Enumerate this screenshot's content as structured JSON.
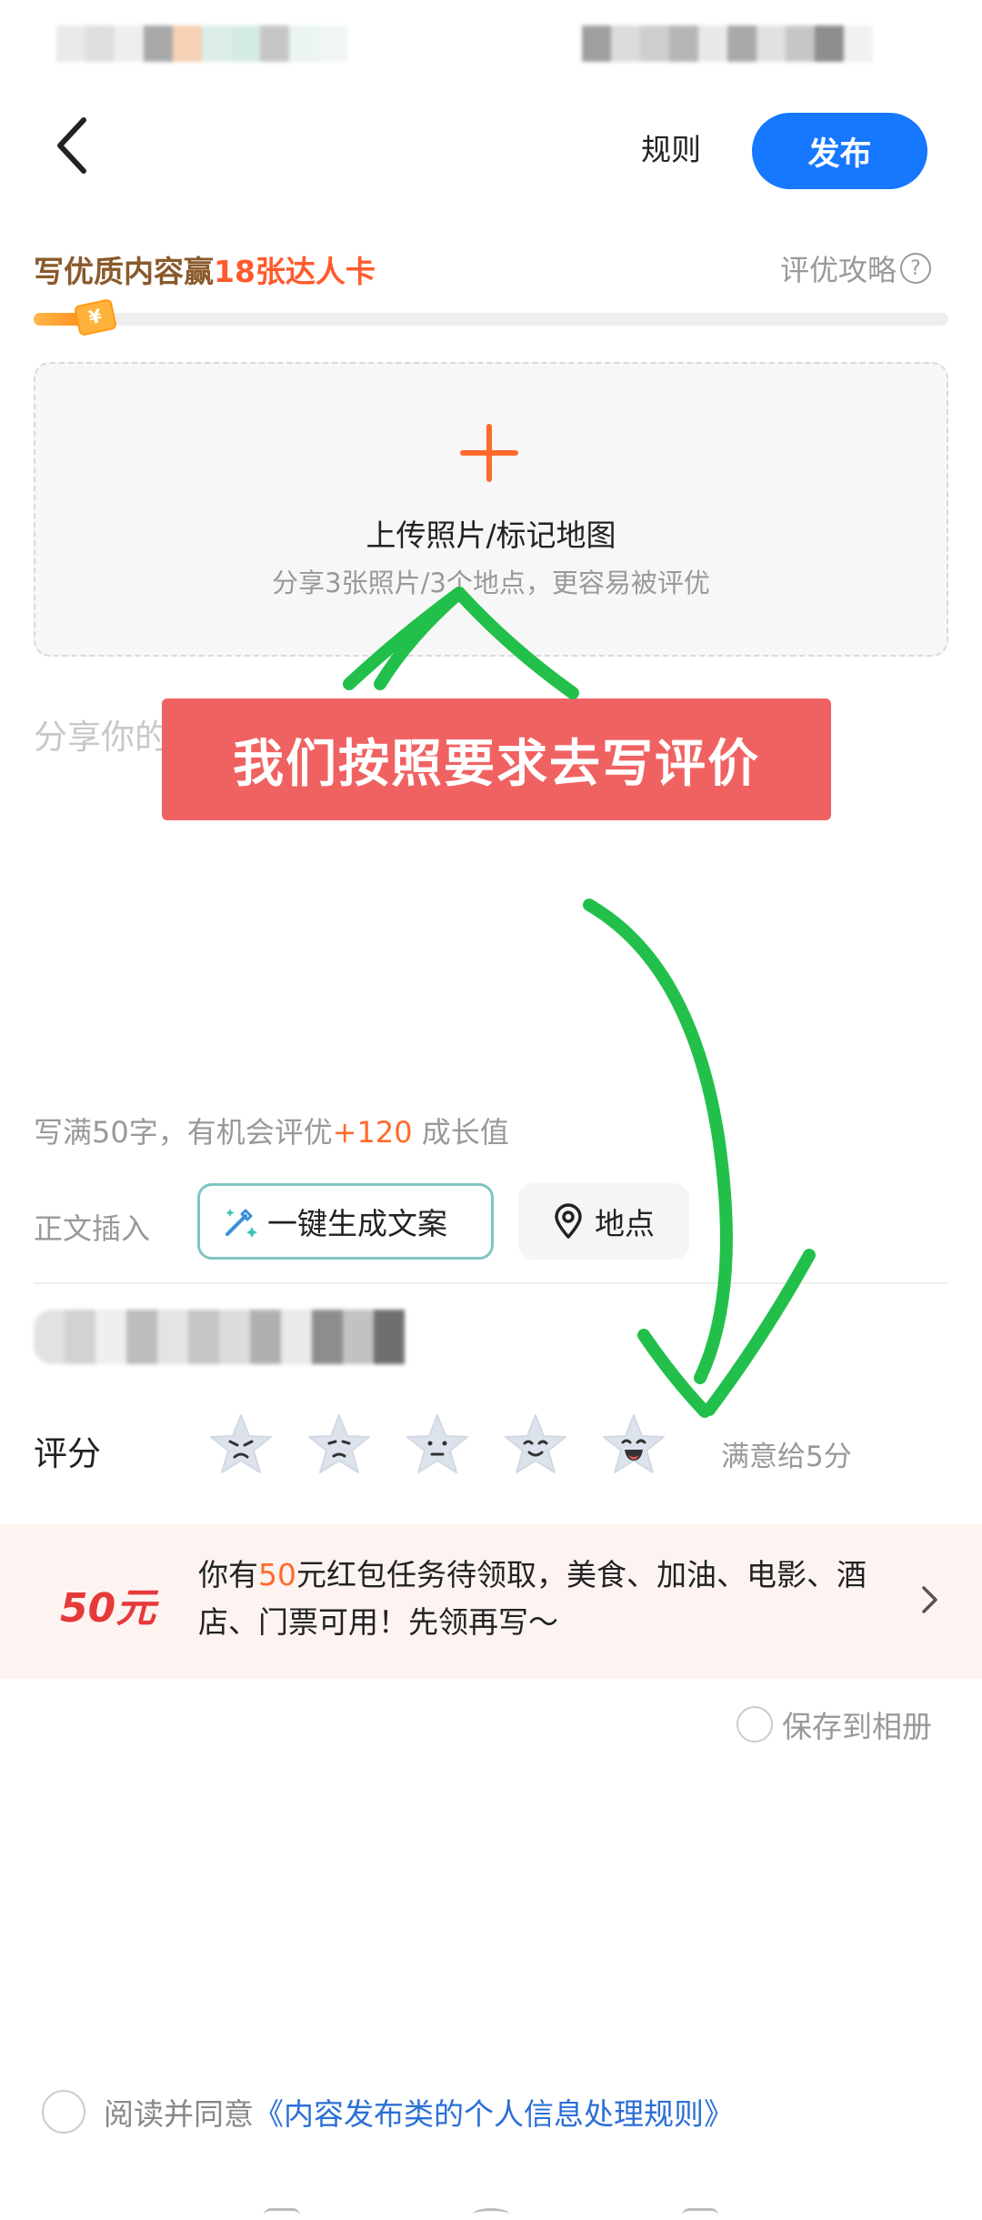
{
  "header": {
    "rules_label": "规则",
    "publish_label": "发布"
  },
  "banner": {
    "title_prefix": "写优质内容赢",
    "title_highlight": "18张达人卡",
    "guide_label": "评优攻略",
    "progress": 0.06
  },
  "upload": {
    "title": "上传照片/标记地图",
    "subtitle": "分享3张照片/3个地点，更容易被评优"
  },
  "content": {
    "placeholder": "分享你的",
    "overlay_text": "我们按照要求去写评价",
    "word_hint_prefix": "写满50字，有机会评优",
    "word_hint_highlight": "+120",
    "word_hint_suffix": " 成长值"
  },
  "insert": {
    "label": "正文插入",
    "generate_label": "一键生成文案",
    "location_label": "地点"
  },
  "rating": {
    "label": "评分",
    "hint": "满意给5分",
    "stars": [
      "angry",
      "sad",
      "neutral",
      "smile",
      "laugh"
    ]
  },
  "promo": {
    "amount": "50元",
    "text_prefix": "你有",
    "text_highlight": "50",
    "text_suffix": "元红包任务待领取，美食、加油、电影、酒店、门票可用！先领再写～"
  },
  "save": {
    "label": "保存到相册"
  },
  "agreement": {
    "prefix": "阅读并同意",
    "link": "《内容发布类的个人信息处理规则》"
  },
  "colors": {
    "primary_blue": "#1677ff",
    "accent_orange": "#ff6a2c",
    "overlay_red": "#f06262",
    "annotation_green": "#22c04a"
  }
}
